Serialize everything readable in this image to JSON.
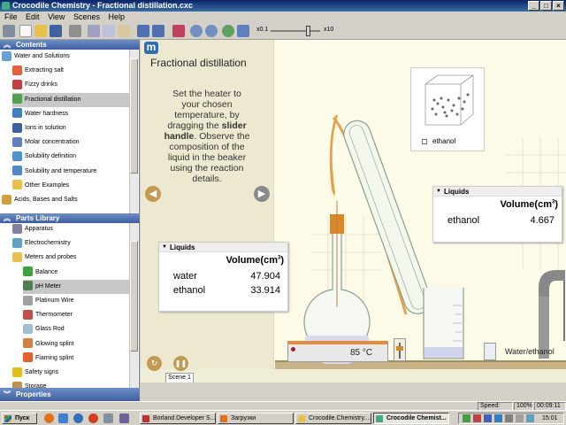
{
  "window": {
    "title": "Crocodile Chemistry - Fractional distillation.cxc"
  },
  "menu": [
    "File",
    "Edit",
    "View",
    "Scenes",
    "Help"
  ],
  "toolbar": {
    "zoom_min": "x0.1",
    "zoom_max": "x10"
  },
  "contents": {
    "header": "Contents",
    "items": [
      {
        "label": "Water and Solutions",
        "icon": "flask-icon",
        "color": "#6a9fd4"
      },
      {
        "label": "Extracting salt",
        "icon": "salt-icon",
        "color": "#e06040"
      },
      {
        "label": "Fizzy drinks",
        "icon": "bottle-icon",
        "color": "#c04040"
      },
      {
        "label": "Fractional distillation",
        "icon": "distillation-icon",
        "color": "#50a050"
      },
      {
        "label": "Water hardness",
        "icon": "water-icon",
        "color": "#4080c0"
      },
      {
        "label": "Ions in solution",
        "icon": "ions-icon",
        "color": "#4060a0"
      },
      {
        "label": "Molar concentration",
        "icon": "beaker-icon",
        "color": "#6080c0"
      },
      {
        "label": "Solubility definition",
        "icon": "solubility-icon",
        "color": "#5090d0"
      },
      {
        "label": "Solubility and temperature",
        "icon": "thermo-solubility-icon",
        "color": "#5088c8"
      },
      {
        "label": "Other Examples",
        "icon": "folder-icon",
        "color": "#e8c050"
      },
      {
        "label": "Acids, Bases and Salts",
        "icon": "acid-icon",
        "color": "#d0a040"
      }
    ]
  },
  "parts": {
    "header": "Parts Library",
    "items": [
      {
        "label": "Apparatus",
        "icon": "apparatus-icon",
        "color": "#8080a0"
      },
      {
        "label": "Electrochemistry",
        "icon": "electro-icon",
        "color": "#60a0c0"
      },
      {
        "label": "Meters and probes",
        "icon": "meter-folder-icon",
        "color": "#e8c050"
      },
      {
        "label": "Balance",
        "icon": "balance-icon",
        "color": "#40a040"
      },
      {
        "label": "pH Meter",
        "icon": "ph-meter-icon",
        "color": "#508050"
      },
      {
        "label": "Platinum Wire",
        "icon": "wire-icon",
        "color": "#a0a0a0"
      },
      {
        "label": "Thermometer",
        "icon": "thermometer-icon",
        "color": "#c05050"
      },
      {
        "label": "Glass Rod",
        "icon": "glass-rod-icon",
        "color": "#a0c0d0"
      },
      {
        "label": "Glowing splint",
        "icon": "splint-icon",
        "color": "#d08040"
      },
      {
        "label": "Flaming splint",
        "icon": "flame-icon",
        "color": "#e06030"
      },
      {
        "label": "Safety signs",
        "icon": "safety-icon",
        "color": "#e0c020"
      },
      {
        "label": "Storage",
        "icon": "storage-icon",
        "color": "#c09050"
      }
    ]
  },
  "properties": {
    "header": "Properties"
  },
  "scene": {
    "logo": "m",
    "title": "Fractional distillation",
    "instruction_pre": "Set the heater to your chosen temperature, by dragging the ",
    "instruction_bold": "slider handle",
    "instruction_post": ". Observe the composition of the liquid in the beaker using the reaction details.",
    "tab": "Scene 1",
    "heater_temp": "85 °C",
    "ethanol_box_label": "ethanol",
    "water_ethanol_label": "Water/ethanol"
  },
  "flask_panel": {
    "header": "Liquids",
    "column": "Volume(cm",
    "sup": "3",
    "close": ")",
    "rows": [
      {
        "name": "water",
        "value": "47.904"
      },
      {
        "name": "ethanol",
        "value": "33.914"
      }
    ]
  },
  "beaker_panel": {
    "header": "Liquids",
    "column": "Volume(cm",
    "sup": "3",
    "close": ")",
    "rows": [
      {
        "name": "ethanol",
        "value": "4.667"
      }
    ]
  },
  "status": {
    "speed": "Speed: x10",
    "zoom": "100%",
    "time": "00:09:11"
  },
  "taskbar": {
    "start": "Пуск",
    "tasks": [
      "Borland Developer S...",
      "Загрузки",
      "Crocodile.Chemistry....",
      "Crocodile Chemist..."
    ],
    "clock": "15:01"
  }
}
